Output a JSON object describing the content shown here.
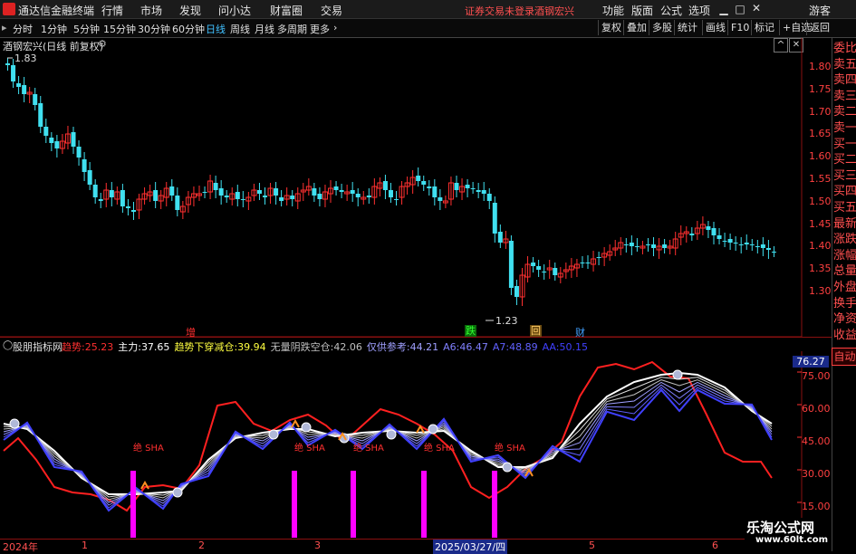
{
  "titlebar": {
    "app_name": "通达信金融终端",
    "menus": [
      "行情",
      "市场",
      "发现",
      "问小达",
      "财富圈",
      "交易"
    ],
    "broker_status": "证券交易未登录",
    "stock_name_red": "酒钢宏兴",
    "right_menus": [
      "功能",
      "版面",
      "公式",
      "选项"
    ],
    "guest": "游客"
  },
  "toolbar": {
    "periods": [
      "分时",
      "1分钟",
      "5分钟",
      "15分钟",
      "30分钟",
      "60分钟",
      "日线",
      "周线",
      "月线",
      "多周期",
      "更多"
    ],
    "active_period": "日线",
    "right_buttons": [
      "复权",
      "叠加",
      "多股",
      "统计",
      "画线",
      "F10",
      "标记",
      "+自选",
      "返回"
    ]
  },
  "main_chart": {
    "title": "酒钢宏兴(日线 前复权)",
    "high_label": "1.83",
    "low_label": "1.23",
    "price_axis": [
      "1.80",
      "1.75",
      "1.70",
      "1.65",
      "1.60",
      "1.55",
      "1.50",
      "1.45",
      "1.40",
      "1.35",
      "1.30"
    ],
    "markers": [
      {
        "text": "增",
        "color": "#ff3030"
      },
      {
        "text": "跌",
        "color": "#30ff30"
      },
      {
        "text": "回",
        "color": "#ffaa30"
      },
      {
        "text": "财",
        "color": "#40a0ff"
      }
    ]
  },
  "indicator": {
    "name": "股朋指标网",
    "items": [
      {
        "label": "趋势",
        "value": "25.23",
        "color": "#ff3030"
      },
      {
        "label": "主力",
        "value": "37.65",
        "color": "#ffffff"
      },
      {
        "label": "趋势下穿减仓",
        "value": "39.94",
        "color": "#ffff40"
      },
      {
        "label": "无量阴跌空仓",
        "value": "42.06",
        "color": "#c0c0c0"
      },
      {
        "label": "仅供参考",
        "value": "44.21",
        "color": "#a0a0ff"
      },
      {
        "label": "A6",
        "value": "46.47",
        "color": "#8080ff"
      },
      {
        "label": "A7",
        "value": "48.89",
        "color": "#6060ff"
      },
      {
        "label": "AA",
        "value": "50.15",
        "color": "#4040ff"
      }
    ],
    "axis": [
      "75.00",
      "60.00",
      "45.00",
      "30.00",
      "15.00"
    ],
    "current_value": "76.27",
    "signal_label": "绝 SHA"
  },
  "date_axis": {
    "labels": [
      "2024年",
      "1",
      "2",
      "3",
      "2025/03/27/四",
      "5",
      "6"
    ],
    "highlight": "2025/03/27/四"
  },
  "sidebar": {
    "items": [
      "委比",
      "卖五",
      "卖四",
      "卖三",
      "卖二",
      "卖一",
      "买一",
      "买二",
      "买三",
      "买四",
      "买五",
      "最新",
      "涨跌",
      "涨幅",
      "总量",
      "外盘",
      "换手",
      "净资",
      "收益"
    ],
    "auto": "自动"
  },
  "watermark": {
    "main": "乐淘公式网",
    "url": "www.60lt.com"
  },
  "colors": {
    "up": "#ff3030",
    "down": "#40e0f0",
    "grid": "#8a1010",
    "highlight": "#ff00ff"
  }
}
